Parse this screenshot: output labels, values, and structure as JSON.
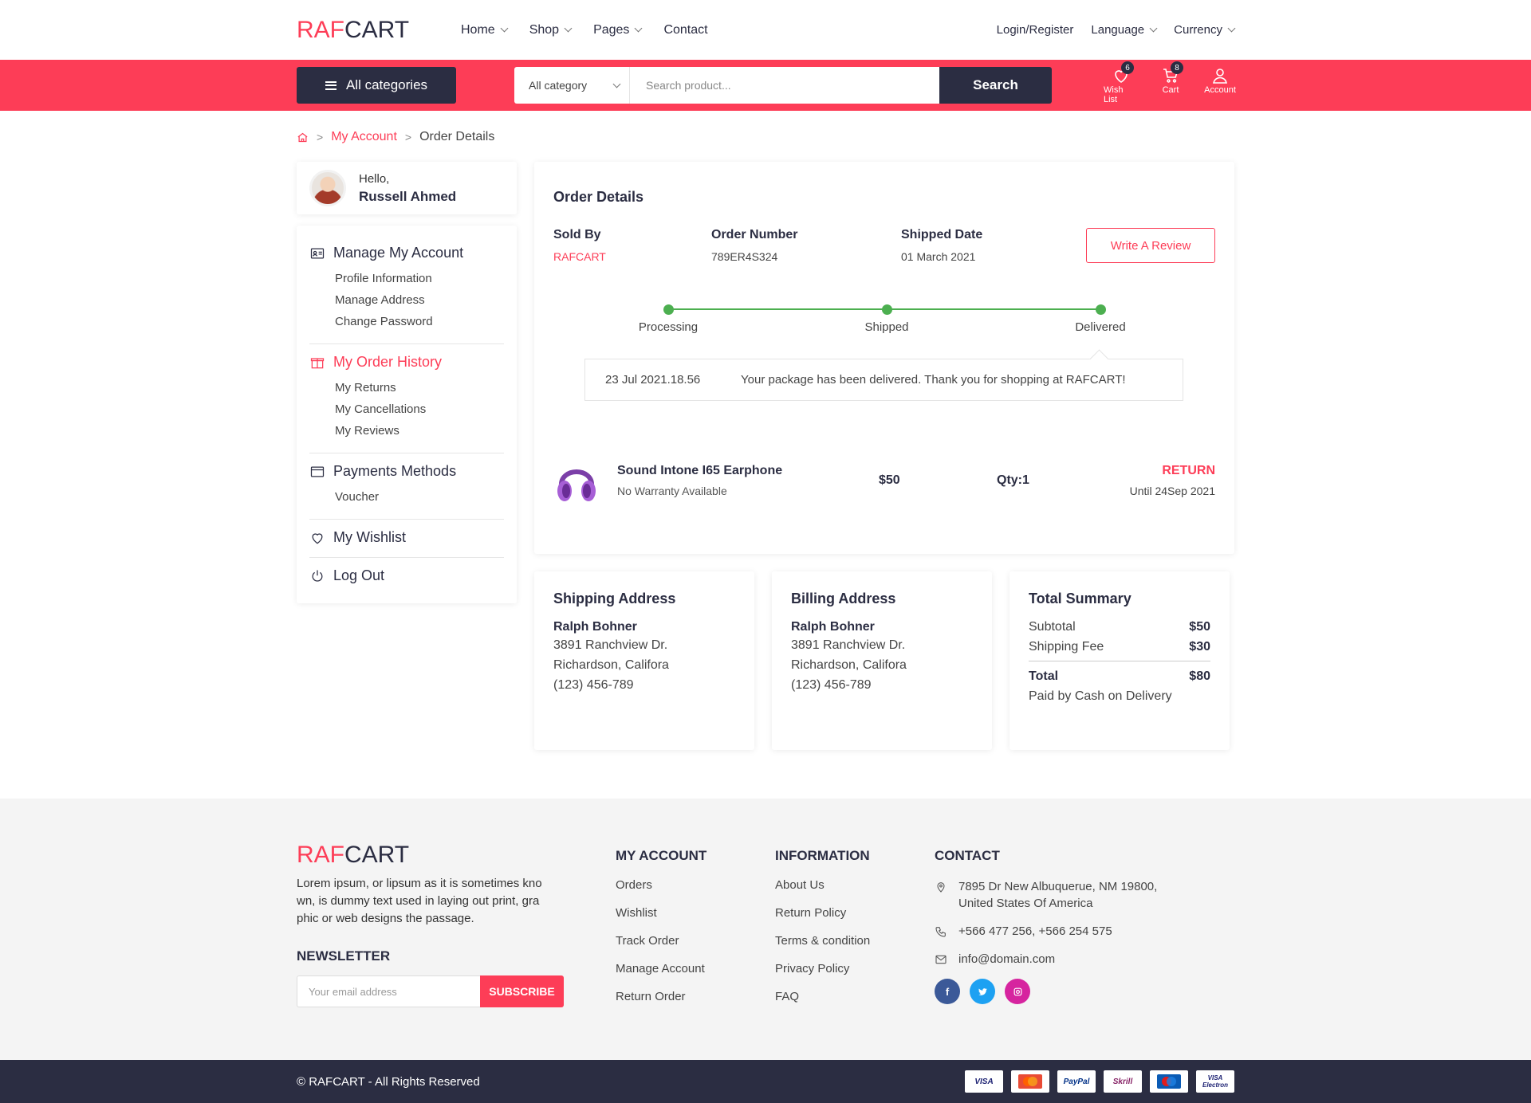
{
  "header": {
    "logo_a": "RAF",
    "logo_b": "CART",
    "nav": [
      {
        "label": "Home",
        "dropdown": true
      },
      {
        "label": "Shop",
        "dropdown": true
      },
      {
        "label": "Pages",
        "dropdown": true
      },
      {
        "label": "Contact",
        "dropdown": false
      }
    ],
    "login": "Login/Register",
    "language": "Language",
    "currency": "Currency"
  },
  "bar": {
    "all_categories": "All categories",
    "category_select": "All category",
    "search_placeholder": "Search product...",
    "search_button": "Search",
    "wishlist_label": "Wish List",
    "wishlist_count": "6",
    "cart_label": "Cart",
    "cart_count": "8",
    "account_label": "Account"
  },
  "breadcrumb": {
    "link": "My Account",
    "current": "Order Details"
  },
  "sidebar": {
    "hello": "Hello,",
    "name": "Russell Ahmed",
    "groups": [
      {
        "title": "Manage My Account",
        "icon": "id-card-icon",
        "active": false,
        "items": [
          "Profile Information",
          "Manage Address",
          "Change Password"
        ]
      },
      {
        "title": "My Order History",
        "icon": "gift-box-icon",
        "active": true,
        "items": [
          "My Returns",
          "My Cancellations",
          "My Reviews"
        ]
      },
      {
        "title": "Payments Methods",
        "icon": "credit-card-icon",
        "active": false,
        "items": [
          "Voucher"
        ]
      },
      {
        "title": "My Wishlist",
        "icon": "heart-icon",
        "active": false,
        "items": []
      },
      {
        "title": "Log Out",
        "icon": "power-icon",
        "active": false,
        "items": []
      }
    ]
  },
  "order": {
    "title": "Order Details",
    "sold_by_label": "Sold By",
    "sold_by": "RAFCART",
    "number_label": "Order Number",
    "number": "789ER4S324",
    "shipped_label": "Shipped Date",
    "shipped": "01 March 2021",
    "review_button": "Write A Review",
    "steps": [
      "Processing",
      "Shipped",
      "Delivered"
    ],
    "status_date": "23 Jul 2021.18.56",
    "status_message": "Your package has been delivered. Thank you for shopping at RAFCART!",
    "product": {
      "name": "Sound Intone I65 Earphone",
      "warranty": "No Warranty Available",
      "price": "$50",
      "qty": "Qty:1",
      "return_label": "RETURN",
      "return_until": "Until 24Sep 2021"
    }
  },
  "shipping": {
    "title": "Shipping Address",
    "name": "Ralph Bohner",
    "line1": "3891 Ranchview Dr.",
    "line2": "Richardson, Califora",
    "phone": "(123) 456-789"
  },
  "billing": {
    "title": "Billing Address",
    "name": "Ralph Bohner",
    "line1": "3891 Ranchview Dr.",
    "line2": "Richardson, Califora",
    "phone": "(123) 456-789"
  },
  "summary": {
    "title": "Total Summary",
    "subtotal_label": "Subtotal",
    "subtotal": "$50",
    "shipping_label": "Shipping Fee",
    "shipping": "$30",
    "total_label": "Total",
    "total": "$80",
    "paid_by": "Paid by Cash on Delivery"
  },
  "footer": {
    "logo_a": "RAF",
    "logo_b": "CART",
    "description": "Lorem ipsum, or lipsum as it is sometimes kno wn, is dummy text used in laying out print, gra phic or web designs the passage.",
    "newsletter_title": "NEWSLETTER",
    "email_placeholder": "Your email address",
    "subscribe": "SUBSCRIBE",
    "account_title": "MY ACCOUNT",
    "account_links": [
      "Orders",
      "Wishlist",
      "Track Order",
      "Manage Account",
      "Return Order"
    ],
    "info_title": "INFORMATION",
    "info_links": [
      "About Us",
      "Return Policy",
      "Terms & condition",
      "Privacy Policy",
      "FAQ"
    ],
    "contact_title": "CONTACT",
    "address": "7895 Dr New Albuquerue, NM 19800, United States Of America",
    "phones": "+566 477 256, +566 254 575",
    "email": "info@domain.com",
    "social_colors": {
      "facebook": "#3b5998",
      "twitter": "#1da1f2",
      "instagram": "#d6249f"
    }
  },
  "bottom": {
    "copyright": "© RAFCART - All Rights Reserved",
    "payment_cards": [
      "VISA",
      "mastercard",
      "PayPal",
      "Skrill",
      "Maestro",
      "VISA Electron"
    ]
  },
  "colors": {
    "accent": "#fd3d57",
    "dark": "#2b2d42",
    "success": "#4caf50"
  }
}
